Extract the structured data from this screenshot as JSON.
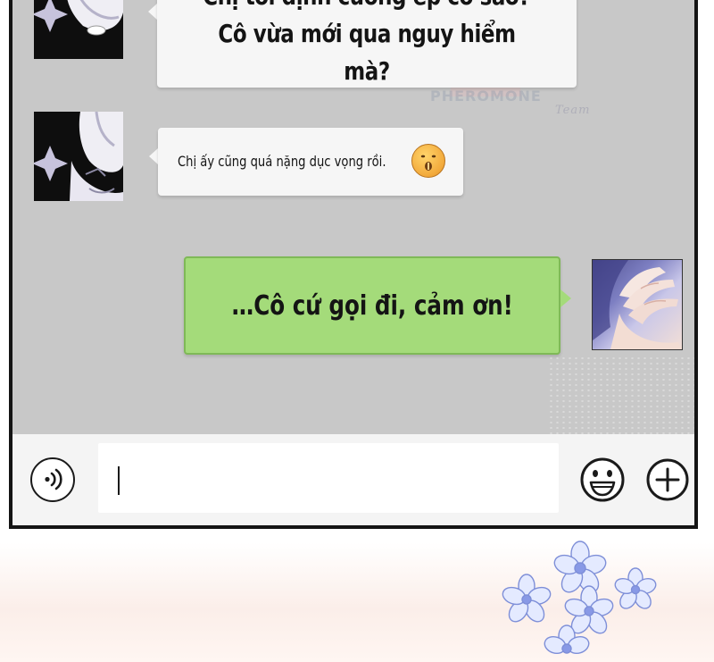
{
  "chat": {
    "messages": [
      {
        "sender": "other",
        "avatar": "bunny-avatar",
        "lines": [
          "Chị tôi định cưỡng ép cô sao?",
          "Cô vừa mới qua nguy hiểm mà?"
        ]
      },
      {
        "sender": "other",
        "avatar": "bunny-avatar",
        "text": "Chị ấy cũng quá nặng dục vọng rồi.",
        "emoji": "zipper-mouth-emoji"
      },
      {
        "sender": "self",
        "avatar": "hand-avatar",
        "text": "…Cô cứ gọi đi, cảm ơn!"
      }
    ]
  },
  "watermark": {
    "brand": "PHEROMONE",
    "team": "Team"
  },
  "input_bar": {
    "input_value": "",
    "icons": [
      "voice-icon",
      "emoji-icon",
      "plus-icon"
    ]
  },
  "colors": {
    "chat_background": "#c8c8c8",
    "incoming_bubble": "#f6f6f6",
    "outgoing_bubble": "#a4db7a",
    "frame_border": "#141414"
  }
}
